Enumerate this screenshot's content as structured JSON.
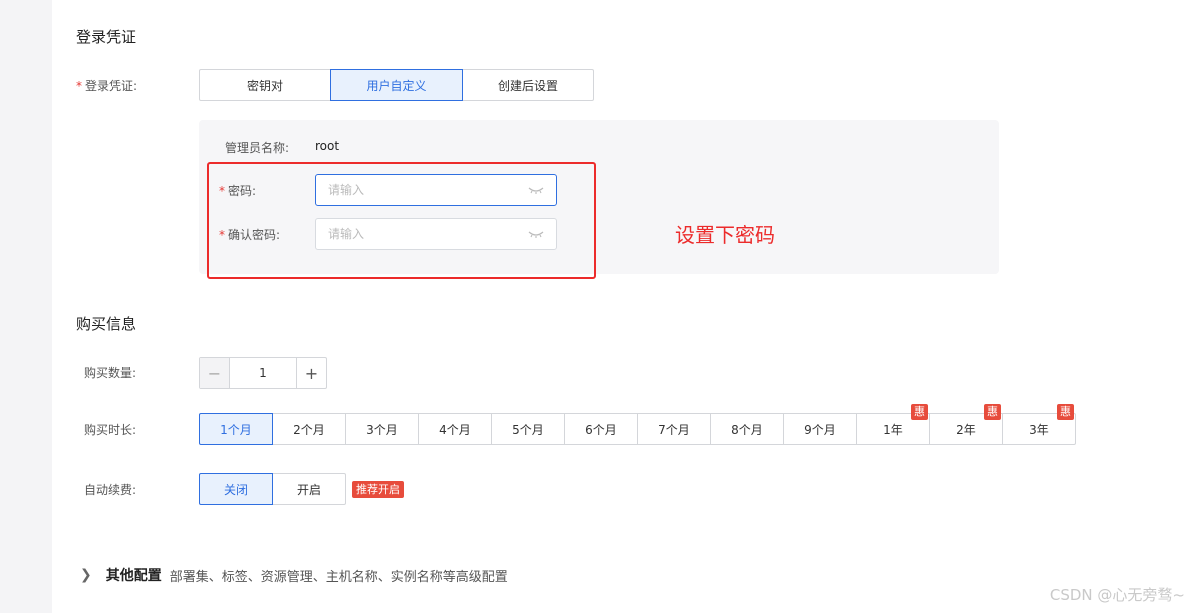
{
  "login": {
    "section_title": "登录凭证",
    "label": "登录凭证:",
    "options": [
      "密钥对",
      "用户自定义",
      "创建后设置"
    ],
    "selected": "用户自定义",
    "admin_label": "管理员名称:",
    "admin_value": "root",
    "password_label": "密码:",
    "password_placeholder": "请输入",
    "confirm_label": "确认密码:",
    "confirm_placeholder": "请输入",
    "annotation": "设置下密码"
  },
  "purchase": {
    "section_title": "购买信息",
    "quantity_label": "购买数量:",
    "quantity_value": "1",
    "duration_label": "购买时长:",
    "durations": [
      "1个月",
      "2个月",
      "3个月",
      "4个月",
      "5个月",
      "6个月",
      "7个月",
      "8个月",
      "9个月",
      "1年",
      "2年",
      "3年"
    ],
    "selected_duration": "1个月",
    "discount_badge": "惠",
    "renew_label": "自动续费:",
    "renew_options": [
      "关闭",
      "开启"
    ],
    "renew_selected": "关闭",
    "recommend_tag": "推荐开启"
  },
  "other": {
    "title": "其他配置",
    "description": "部署集、标签、资源管理、主机名称、实例名称等高级配置"
  },
  "watermark": "CSDN @心无旁骛~",
  "colors": {
    "accent": "#2f6fe0",
    "annotation_red": "#ec2b2b",
    "badge_red": "#e74c3c"
  }
}
